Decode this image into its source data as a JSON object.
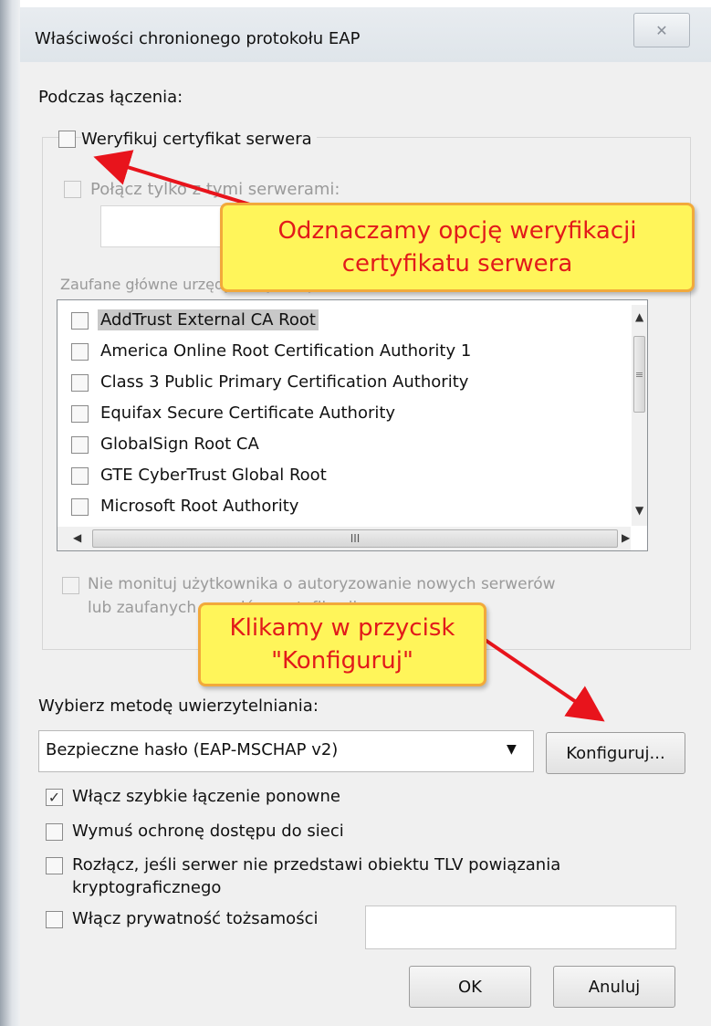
{
  "window": {
    "title": "Właściwości chronionego protokołu EAP",
    "close_label": "✕"
  },
  "connect_section": {
    "heading": "Podczas łączenia:",
    "verify_cert": {
      "label": "Weryfikuj certyfikat serwera",
      "checked": false
    },
    "connect_servers": {
      "label": "Połącz tylko z tymi serwerami:",
      "value": ""
    },
    "trusted_ca_label": "Zaufane główne urzędy certyfikacji:",
    "ca_list": [
      {
        "label": "AddTrust External CA Root",
        "checked": false,
        "selected": true
      },
      {
        "label": "America Online Root Certification Authority 1",
        "checked": false
      },
      {
        "label": "Class 3 Public Primary Certification Authority",
        "checked": false
      },
      {
        "label": "Equifax Secure Certificate Authority",
        "checked": false
      },
      {
        "label": "GlobalSign Root CA",
        "checked": false
      },
      {
        "label": "GTE CyberTrust Global Root",
        "checked": false
      },
      {
        "label": "Microsoft Root Authority",
        "checked": false
      }
    ],
    "scroll_grip": "≡",
    "hscroll_grip": "III",
    "no_prompt": {
      "line1": "Nie monituj użytkownika o autoryzowanie nowych serwerów",
      "line2": "lub zaufanych urzędów certyfikacji."
    }
  },
  "auth_method": {
    "label": "Wybierz metodę uwierzytelniania:",
    "selected": "Bezpieczne hasło (EAP-MSCHAP v2)",
    "configure_button": "Konfiguruj..."
  },
  "options": {
    "fast_reconnect": {
      "label": "Włącz szybkie łączenie ponowne",
      "checked": true
    },
    "nap": {
      "label": "Wymuś ochronę dostępu do sieci",
      "checked": false
    },
    "disconnect": {
      "line1": "Rozłącz, jeśli serwer nie przedstawi obiektu TLV powiązania",
      "line2": "kryptograficznego",
      "checked": false
    },
    "identity_privacy": {
      "label": "Włącz prywatność tożsamości",
      "checked": false,
      "value": ""
    }
  },
  "buttons": {
    "ok": "OK",
    "cancel": "Anuluj"
  },
  "annotations": {
    "callout1": {
      "line1": "Odznaczamy opcję weryfikacji",
      "line2": "certyfikatu serwera"
    },
    "callout2": {
      "line1": "Klikamy w przycisk",
      "line2": "\"Konfiguruj\""
    },
    "arrow_color": "#e8141c",
    "callout_fill": "#fff55a",
    "callout_border": "#f2a93b"
  }
}
